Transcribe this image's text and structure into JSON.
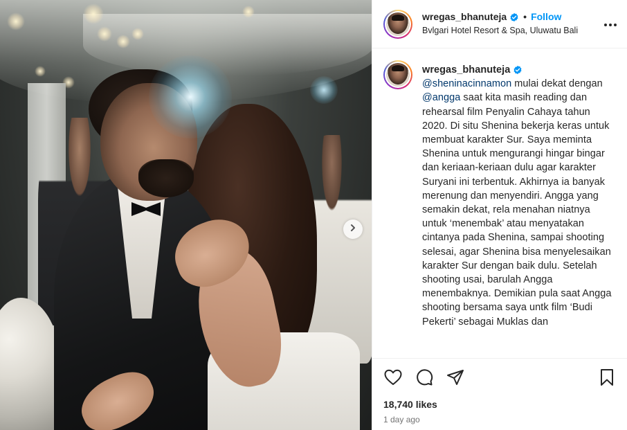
{
  "post": {
    "username": "wregas_bhanuteja",
    "follow_label": "Follow",
    "separator": "•",
    "location": "Bvlgari Hotel Resort & Spa, Uluwatu Bali",
    "verified": true
  },
  "caption": {
    "username": "wregas_bhanuteja",
    "mention_1": "@sheninacinnamon",
    "text_1": " mulai dekat dengan ",
    "mention_2": "@angga",
    "text_2": " saat kita masih reading dan rehearsal film Penyalin Cahaya tahun 2020. Di situ Shenina bekerja keras untuk membuat karakter Sur. Saya meminta Shenina untuk mengurangi hingar bingar dan keriaan-keriaan dulu agar karakter Suryani ini terbentuk. Akhirnya ia banyak merenung dan menyendiri. Angga yang semakin dekat, rela menahan niatnya untuk ‘menembak’ atau menyatakan cintanya pada Shenina, sampai shooting selesai, agar Shenina bisa menyelesaikan karakter Sur dengan baik dulu. Setelah shooting usai, barulah Angga menembaknya. Demikian pula saat Angga shooting bersama saya untk film ‘Budi Pekerti’ sebagai Muklas dan"
  },
  "stats": {
    "likes": "18,740 likes",
    "time_ago": "1 day ago"
  },
  "icons": {
    "more": "more-options-icon",
    "like": "heart-icon",
    "comment": "comment-icon",
    "share": "share-icon",
    "save": "bookmark-icon",
    "next": "chevron-right-icon",
    "verified": "verified-badge-icon"
  },
  "colors": {
    "follow": "#0095f6",
    "verified": "#0095f6",
    "mention": "#00376b",
    "muted": "#737373"
  }
}
